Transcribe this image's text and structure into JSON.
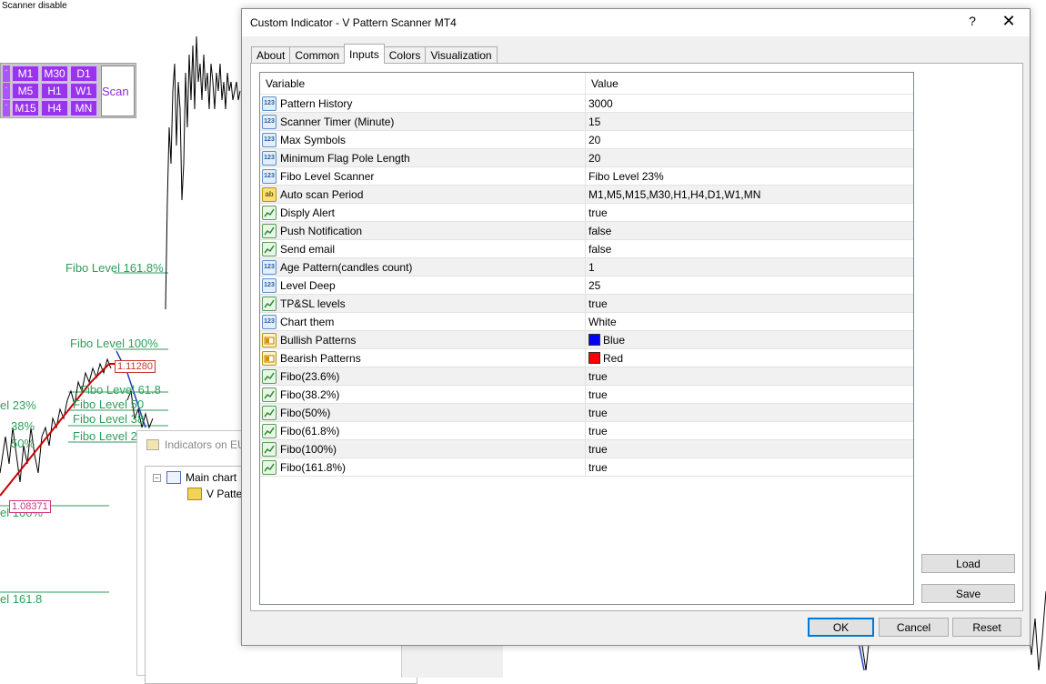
{
  "background": {
    "scanner_status": "Scanner disable",
    "timeframes": [
      "M1",
      "M30",
      "D1",
      "M5",
      "H1",
      "W1",
      "M15",
      "H4",
      "MN"
    ],
    "scan_label": "Scan",
    "fibo_labels": {
      "f161": "Fibo Level 161.8%",
      "f100": "Fibo Level 100%",
      "f618": "Fibo Level 61.8",
      "f50": "Fibo Level 50",
      "f382": "Fibo Level 38",
      "f236": "Fibo Level 2",
      "left23": "el 23%",
      "left38": "38%",
      "left50": "50%",
      "left100": "el 100%",
      "left161": "el 161.8"
    },
    "price_red": "1.11280",
    "price_pink": "1.08371"
  },
  "indicators_window": {
    "title": "Indicators on EU",
    "main_chart": "Main chart",
    "item": "V Patter"
  },
  "dialog": {
    "title": "Custom Indicator - V Pattern Scanner MT4",
    "help": "?",
    "close": "✕",
    "tabs": [
      "About",
      "Common",
      "Inputs",
      "Colors",
      "Visualization"
    ],
    "active_tab": "Inputs",
    "columns": {
      "variable": "Variable",
      "value": "Value"
    },
    "rows": [
      {
        "variable": "Pattern History",
        "value": "3000",
        "icon": "num"
      },
      {
        "variable": "Scanner Timer (Minute)",
        "value": "15",
        "icon": "num"
      },
      {
        "variable": "Max Symbols",
        "value": "20",
        "icon": "num"
      },
      {
        "variable": "Minimum Flag Pole Length",
        "value": "20",
        "icon": "num"
      },
      {
        "variable": "Fibo Level Scanner",
        "value": "Fibo Level 23%",
        "icon": "num"
      },
      {
        "variable": "Auto scan Period",
        "value": "M1,M5,M15,M30,H1,H4,D1,W1,MN",
        "icon": "str"
      },
      {
        "variable": "Disply Alert",
        "value": "true",
        "icon": "bool"
      },
      {
        "variable": "Push Notification",
        "value": "false",
        "icon": "bool"
      },
      {
        "variable": "Send email",
        "value": "false",
        "icon": "bool"
      },
      {
        "variable": "Age Pattern(candles count)",
        "value": "1",
        "icon": "num"
      },
      {
        "variable": "Level Deep",
        "value": "25",
        "icon": "num"
      },
      {
        "variable": "TP&SL levels",
        "value": "true",
        "icon": "bool"
      },
      {
        "variable": "Chart them",
        "value": "White",
        "icon": "num"
      },
      {
        "variable": "Bullish Patterns",
        "value": "Blue",
        "icon": "color",
        "swatch": "#0000ff"
      },
      {
        "variable": "Bearish Patterns",
        "value": "Red",
        "icon": "color",
        "swatch": "#ff0000"
      },
      {
        "variable": "Fibo(23.6%)",
        "value": "true",
        "icon": "bool"
      },
      {
        "variable": "Fibo(38.2%)",
        "value": "true",
        "icon": "bool"
      },
      {
        "variable": "Fibo(50%)",
        "value": "true",
        "icon": "bool"
      },
      {
        "variable": "Fibo(61.8%)",
        "value": "true",
        "icon": "bool"
      },
      {
        "variable": "Fibo(100%)",
        "value": "true",
        "icon": "bool"
      },
      {
        "variable": "Fibo(161.8%)",
        "value": "true",
        "icon": "bool"
      }
    ],
    "buttons": {
      "load": "Load",
      "save": "Save",
      "ok": "OK",
      "cancel": "Cancel",
      "reset": "Reset"
    },
    "icon_labels": {
      "num": "123",
      "str": "ab"
    }
  }
}
